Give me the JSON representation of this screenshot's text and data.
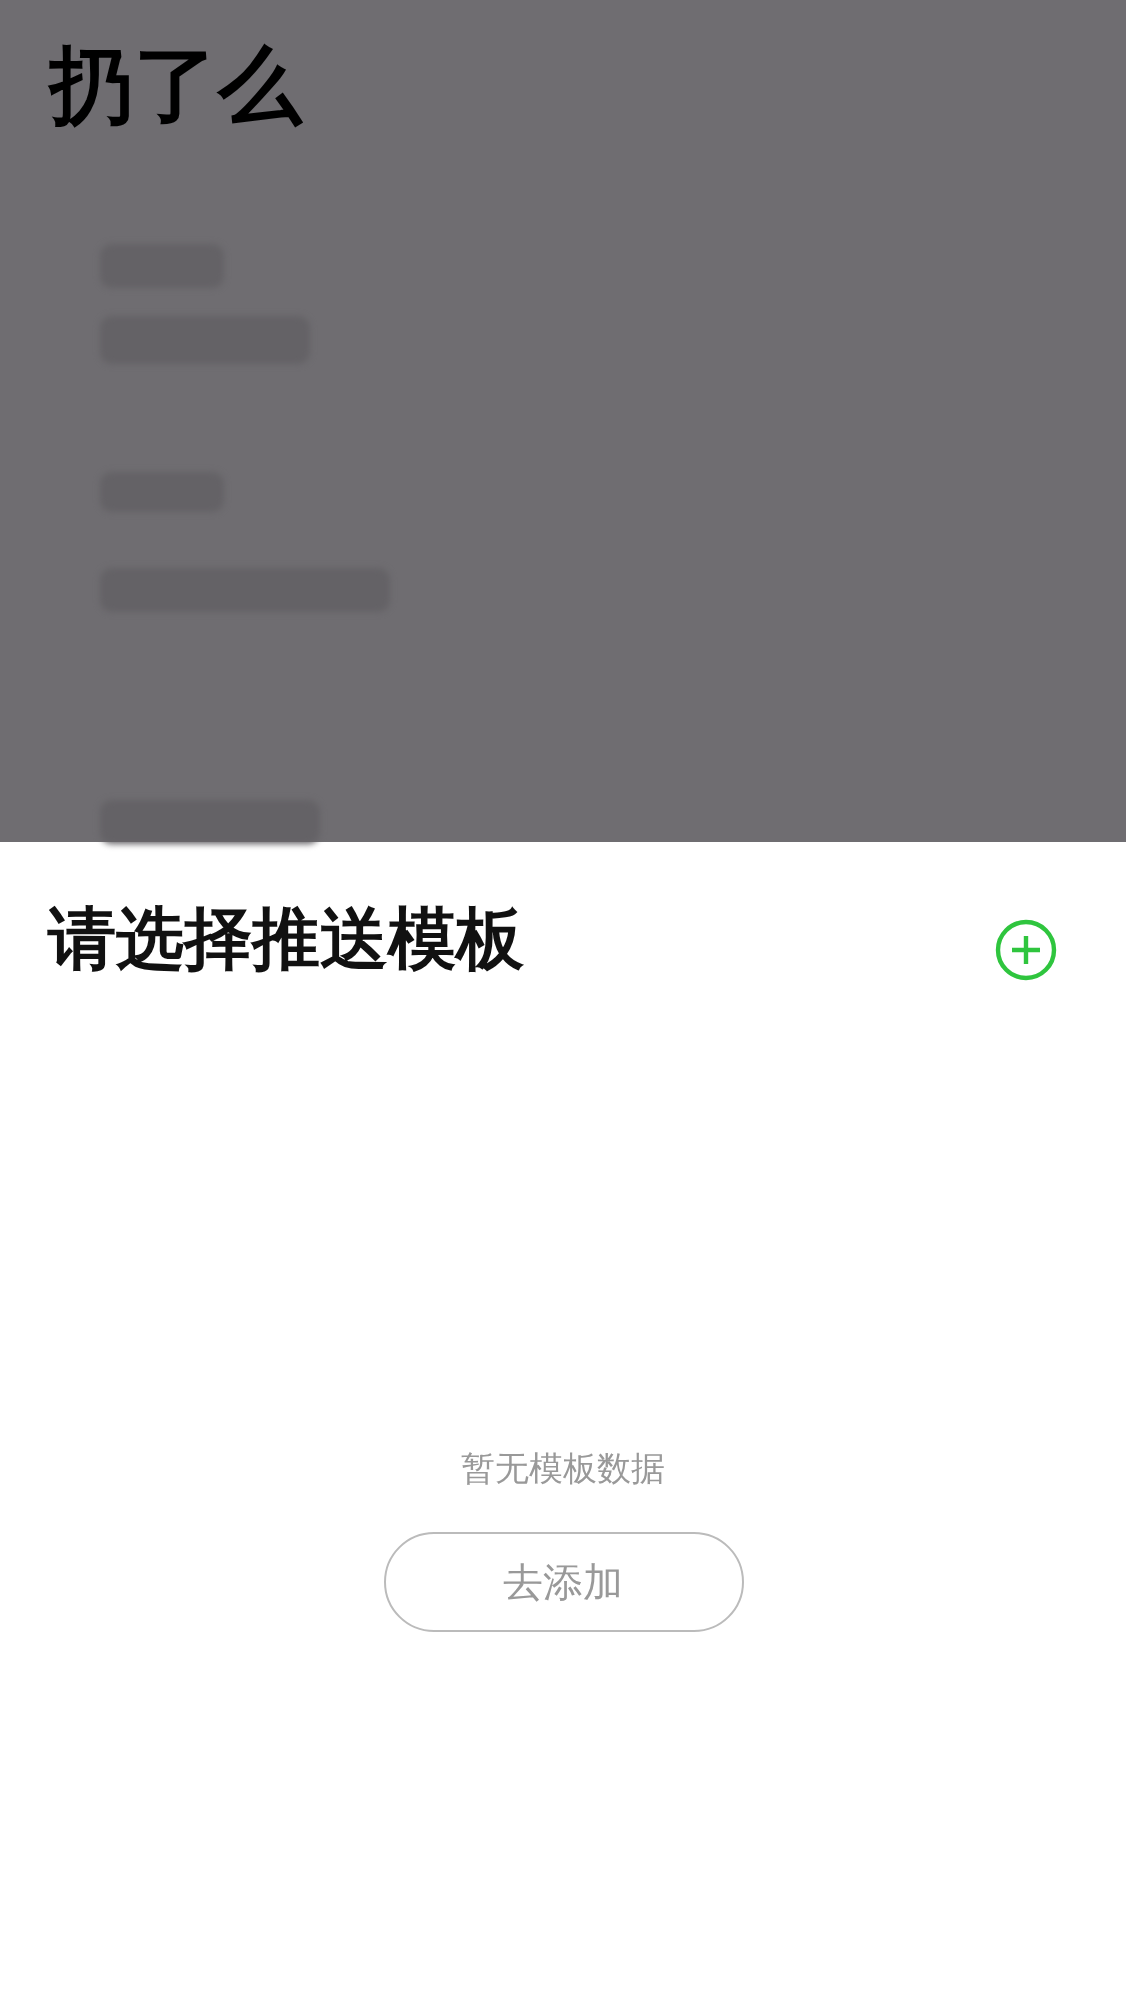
{
  "app_title": "扔了么",
  "sheet": {
    "title": "请选择推送模板",
    "empty_text": "暂无模板数据",
    "add_button": "去添加"
  }
}
